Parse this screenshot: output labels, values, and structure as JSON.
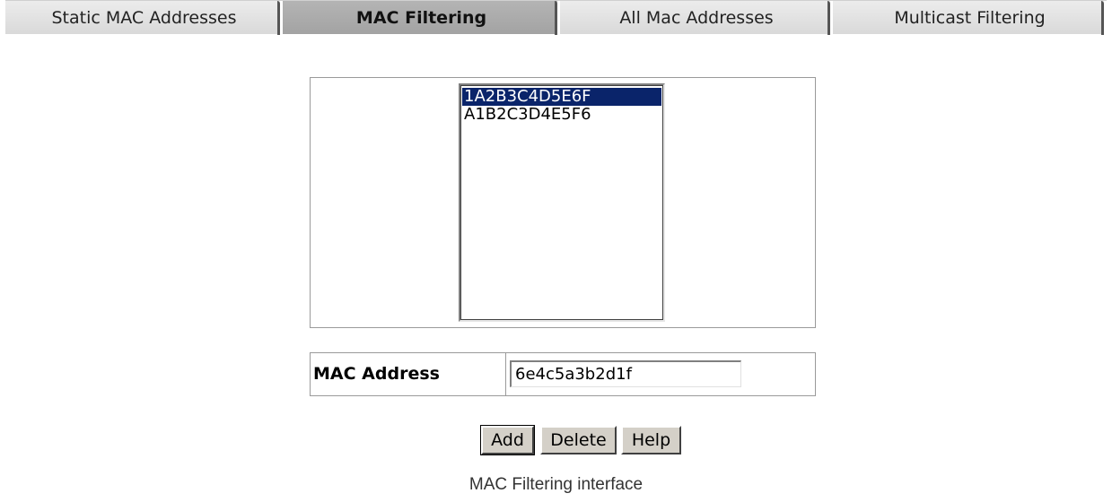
{
  "tabs": [
    {
      "label": "Static MAC Addresses",
      "active": false
    },
    {
      "label": "MAC Filtering",
      "active": true
    },
    {
      "label": "All Mac Addresses",
      "active": false
    },
    {
      "label": "Multicast Filtering",
      "active": false
    }
  ],
  "mac_list": {
    "items": [
      "1A2B3C4D5E6F",
      "A1B2C3D4E5F6"
    ],
    "selected": "1A2B3C4D5E6F"
  },
  "mac_field": {
    "label": "MAC Address",
    "value": "6e4c5a3b2d1f"
  },
  "buttons": {
    "add": "Add",
    "delete": "Delete",
    "help": "Help"
  },
  "caption": "MAC Filtering interface",
  "colors": {
    "selection": "#0a246a",
    "active_tab": "#a9a9a9",
    "inactive_tab": "#e3e3e3"
  }
}
